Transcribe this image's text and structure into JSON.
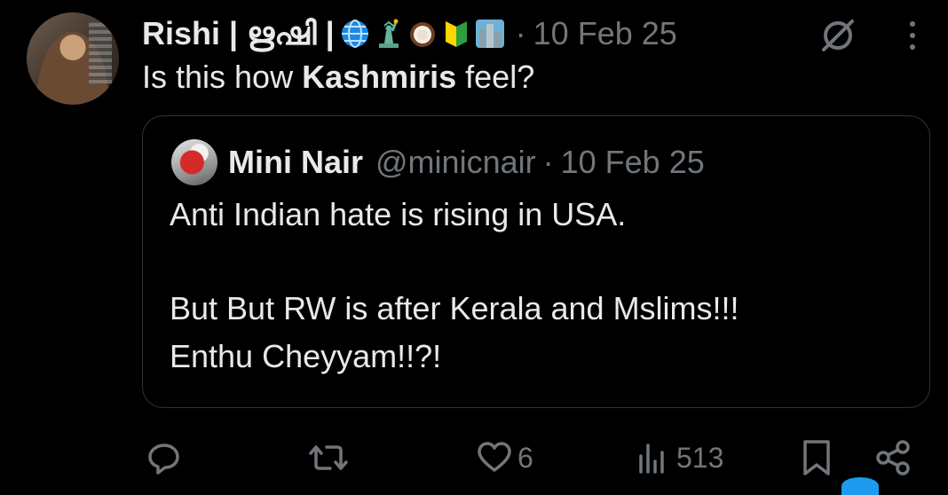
{
  "post": {
    "author_name": "Rishi | ഋഷി |",
    "emojis": [
      "globe-icon",
      "statue-of-liberty-icon",
      "coconut-icon",
      "beginner-badge-icon",
      "cityscape-icon"
    ],
    "date_separator": "·",
    "date": "10 Feb 25",
    "text_prefix": "Is this how ",
    "text_bold": "Kashmiris",
    "text_suffix": " feel?"
  },
  "quoted": {
    "author_name": "Mini Nair",
    "handle": "@minicnair",
    "date_separator": "·",
    "date": "10 Feb 25",
    "lines": [
      "Anti Indian hate is rising in USA.",
      "But But RW is after Kerala and Mslims!!!",
      "Enthu Cheyyam!!?!"
    ]
  },
  "actions": {
    "reply_count": "",
    "repost_count": "",
    "like_count": "6",
    "views_count": "513"
  }
}
